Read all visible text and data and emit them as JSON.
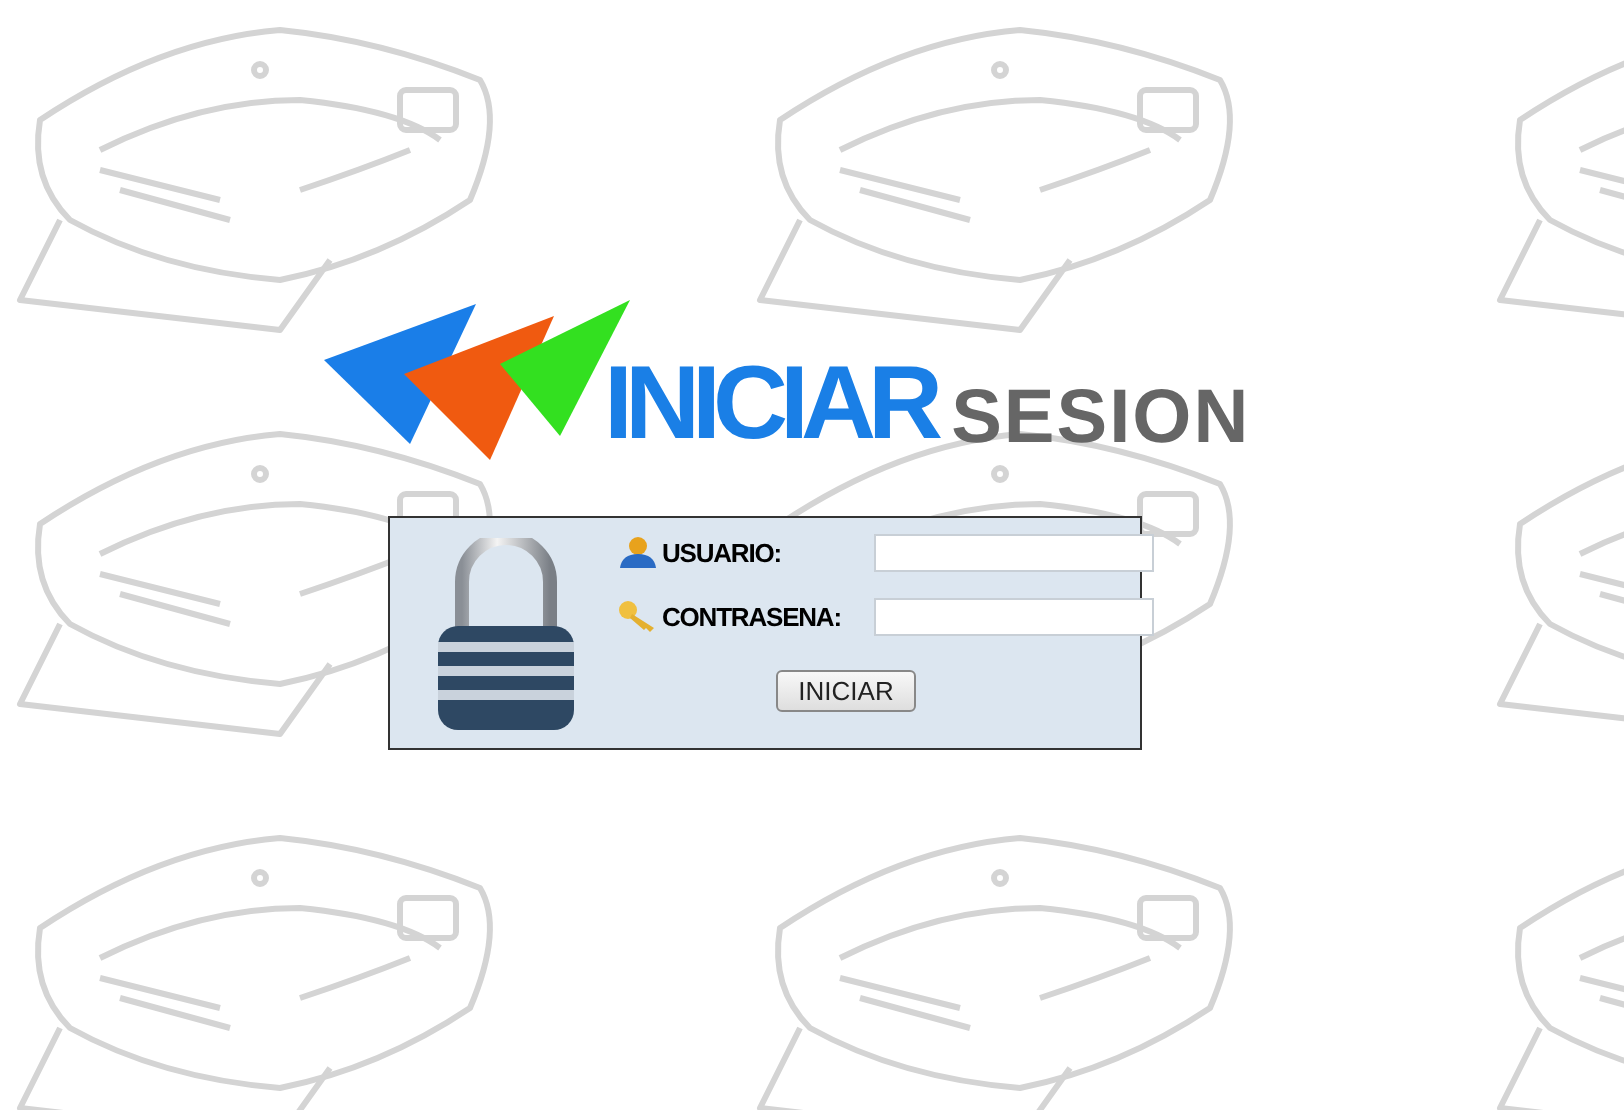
{
  "logo": {
    "title": "INICIAR",
    "subtitle": "SESION"
  },
  "login": {
    "fields": [
      {
        "kind": "user",
        "label": "USUARIO:"
      },
      {
        "kind": "password",
        "label": "CONTRASENA:"
      }
    ],
    "button": "INICIAR"
  }
}
